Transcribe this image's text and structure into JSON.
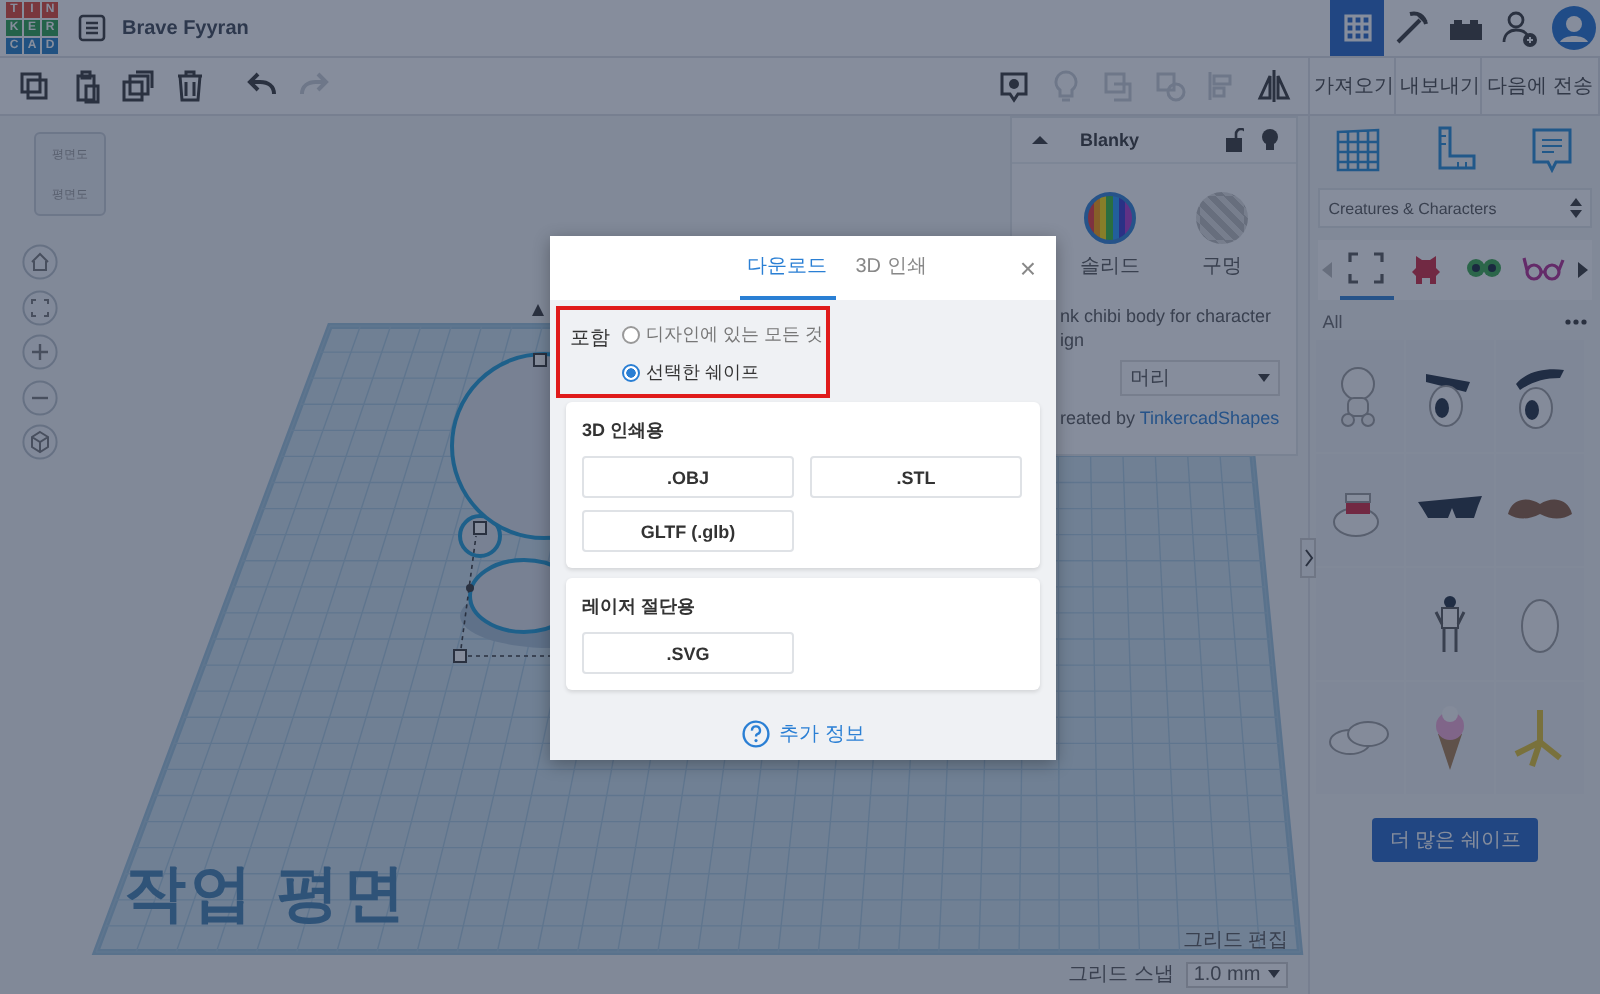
{
  "app": {
    "title": "Brave Fyyran",
    "logo_letters": [
      "T",
      "I",
      "N",
      "K",
      "E",
      "R",
      "C",
      "A",
      "D"
    ]
  },
  "nav": [
    {
      "kind": "grid",
      "selected": true
    },
    {
      "kind": "pickaxe",
      "selected": false
    },
    {
      "kind": "bricks",
      "selected": false
    },
    {
      "kind": "add-user",
      "selected": false
    },
    {
      "kind": "avatar",
      "selected": false
    }
  ],
  "toolbar": {
    "left": [
      {
        "kind": "copy",
        "disabled": false
      },
      {
        "kind": "paste",
        "disabled": false
      },
      {
        "kind": "duplicate",
        "disabled": false
      },
      {
        "kind": "trash",
        "disabled": false
      },
      {
        "kind": "undo",
        "disabled": false
      },
      {
        "kind": "redo",
        "disabled": true
      }
    ],
    "right": [
      {
        "kind": "note",
        "disabled": false
      },
      {
        "kind": "bulb",
        "disabled": true
      },
      {
        "kind": "group",
        "disabled": true
      },
      {
        "kind": "ungroup",
        "disabled": true
      },
      {
        "kind": "align",
        "disabled": true
      },
      {
        "kind": "mirror",
        "disabled": false
      }
    ],
    "actions": [
      "가져오기",
      "내보내기",
      "다음에 전송"
    ]
  },
  "view_cube": {
    "top": "평면도",
    "front": "평면도"
  },
  "view_controls": [
    {
      "kind": "home"
    },
    {
      "kind": "fit"
    },
    {
      "kind": "zoom-in"
    },
    {
      "kind": "zoom-out"
    },
    {
      "kind": "perspective"
    }
  ],
  "workplane": {
    "label": "작업 평면"
  },
  "inspector": {
    "name": "Blanky",
    "locked": false,
    "materials": [
      {
        "label": "솔리드",
        "kind": "solid",
        "selected": true
      },
      {
        "label": "구멍",
        "kind": "hole",
        "selected": false
      }
    ],
    "description": [
      "nk chibi body for character",
      "ign"
    ],
    "part": "머리",
    "credit": "reated by",
    "credit_link": "TinkercadShapes"
  },
  "grid_footer": {
    "edit": "그리드 편집",
    "snap_label": "그리드 스냅",
    "snap_value": "1.0 mm"
  },
  "library": {
    "tools": [
      {
        "kind": "grid"
      },
      {
        "kind": "ruler"
      },
      {
        "kind": "note"
      }
    ],
    "category": "Creatures & Characters",
    "tabs": [
      {
        "kind": "frame",
        "selected": true
      },
      {
        "kind": "creature",
        "selected": false
      },
      {
        "kind": "eyes",
        "selected": false
      },
      {
        "kind": "glasses",
        "selected": false
      }
    ],
    "filter": "All",
    "more": "더 많은 쉐이프"
  },
  "dialog": {
    "tabs": [
      {
        "label": "다운로드",
        "selected": true
      },
      {
        "label": "3D 인쇄",
        "selected": false
      }
    ],
    "close": "×",
    "include_label": "포함",
    "include_highlighted": true,
    "options": [
      {
        "label": "디자인에 있는 모든 것",
        "selected": false
      },
      {
        "label": "선택한 쉐이프",
        "selected": true
      }
    ],
    "sections": [
      {
        "title": "3D 인쇄용",
        "buttons": [
          ".OBJ",
          ".STL",
          "GLTF (.glb)"
        ]
      },
      {
        "title": "레이저 절단용",
        "buttons": [
          ".SVG"
        ]
      }
    ],
    "help": "추가 정보"
  }
}
